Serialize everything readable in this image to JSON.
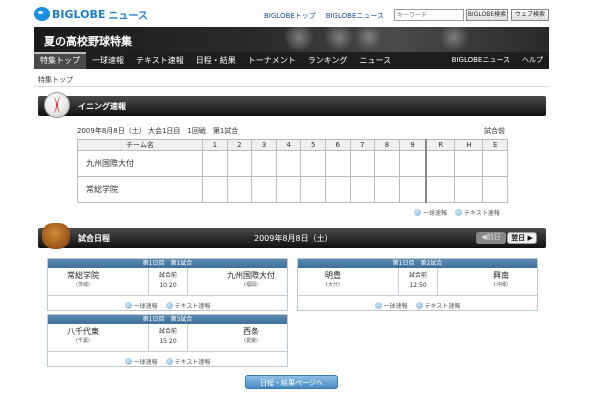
{
  "header": {
    "logo_text": "BIGLOBE",
    "logo_suffix": "ニュース",
    "links": [
      "BIGLOBEトップ",
      "BIGLOBEニュース"
    ],
    "search_placeholder": "キーワード",
    "search_buttons": [
      "BIGLOBE検索",
      "ウェブ検索"
    ]
  },
  "banner": {
    "title": "夏の高校野球特集"
  },
  "nav": {
    "items": [
      "特集トップ",
      "一球速報",
      "テキスト速報",
      "日程・結果",
      "トーナメント",
      "ランキング",
      "ニュース"
    ],
    "active_index": 0,
    "right_items": [
      "BIGLOBEニュース",
      "ヘルプ"
    ]
  },
  "breadcrumb": "特集トップ",
  "inning": {
    "section_label": "イニング速報",
    "meta": "2009年8月8日（土） 大会1日目　1回戦　第1試合",
    "status": "試合前",
    "columns": [
      "チーム名",
      "1",
      "2",
      "3",
      "4",
      "5",
      "6",
      "7",
      "8",
      "9",
      "R",
      "H",
      "E"
    ],
    "teams": [
      "九州国際大付",
      "常総学院"
    ],
    "links": [
      "一球速報",
      "テキスト速報"
    ]
  },
  "schedule": {
    "section_label": "試合日程",
    "date": "2009年8月8日（土）",
    "prev_label": "◀前日",
    "next_label": "翌日 ▶",
    "games": [
      {
        "head": "第1日目　第1試合",
        "home": "常総学院",
        "home_pref": "(茨城)",
        "status": "試合前",
        "time": "10:20",
        "away": "九州国際大付",
        "away_pref": "(福岡)",
        "links": [
          "一球速報",
          "テキスト速報"
        ]
      },
      {
        "head": "第1日目　第2試合",
        "home": "明豊",
        "home_pref": "(大分)",
        "status": "試合前",
        "time": "12:50",
        "away": "興南",
        "away_pref": "(沖縄)",
        "links": [
          "一球速報",
          "テキスト速報"
        ]
      },
      {
        "head": "第1日目　第3試合",
        "home": "八千代東",
        "home_pref": "(千葉)",
        "status": "試合前",
        "time": "15:20",
        "away": "西条",
        "away_pref": "(愛媛)",
        "links": [
          "一球速報",
          "テキスト速報"
        ]
      }
    ],
    "results_button": "日程・結果ページへ"
  }
}
